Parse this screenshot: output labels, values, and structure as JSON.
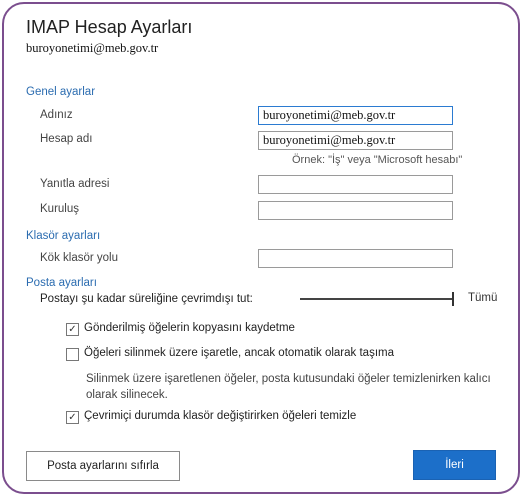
{
  "dialog": {
    "title": "IMAP Hesap Ayarları",
    "account": "buroyonetimi@meb.gov.tr"
  },
  "general": {
    "heading": "Genel ayarlar",
    "name_label": "Adınız",
    "name_value": "buroyonetimi@meb.gov.tr",
    "account_name_label": "Hesap adı",
    "account_name_value": "buroyonetimi@meb.gov.tr",
    "example_hint": "Örnek: \"İş\" veya \"Microsoft hesabı\"",
    "reply_label": "Yanıtla adresi",
    "reply_value": "",
    "org_label": "Kuruluş",
    "org_value": ""
  },
  "folder": {
    "heading": "Klasör ayarları",
    "root_label": "Kök klasör yolu",
    "root_value": ""
  },
  "mail": {
    "heading": "Posta ayarları",
    "offline_label": "Postayı şu kadar süreliğine çevrimdışı tut:",
    "offline_value": "Tümü",
    "offline_level": 1.0,
    "save_sent_label": "Gönderilmiş öğelerin kopyasını kaydetme",
    "save_sent_checked": true,
    "mark_deleted_label": "Öğeleri silinmek üzere işaretle, ancak otomatik olarak taşıma",
    "mark_deleted_checked": false,
    "mark_deleted_desc": "Silinmek üzere işaretlenen öğeler, posta kutusundaki öğeler temizlenirken kalıcı olarak silinecek.",
    "purge_label": "Çevrimiçi durumda klasör değiştirirken öğeleri temizle",
    "purge_checked": true
  },
  "buttons": {
    "reset": "Posta ayarlarını sıfırla",
    "next": "İleri"
  },
  "colors": {
    "accent": "#2b6cb0",
    "primary_button": "#1c6fc9",
    "frame": "#7b4e8e"
  }
}
